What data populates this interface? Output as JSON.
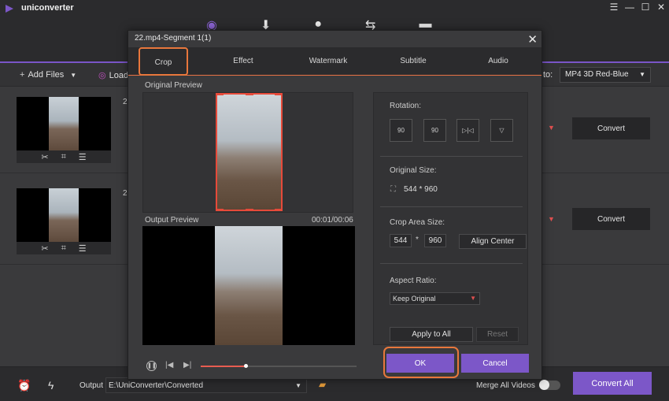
{
  "app": {
    "name": "uniconverter",
    "window_controls": [
      "☰",
      "—",
      "☐",
      "✕"
    ],
    "top_nav_icons": [
      "convert-icon",
      "download-icon",
      "burn-icon",
      "transfer-icon",
      "toolbox-icon"
    ]
  },
  "toolbar": {
    "add_files_label": "Add Files",
    "load_label": "Load",
    "convert_to_label": "to:",
    "format_value": "MP4 3D Red-Blue"
  },
  "file_rows": [
    {
      "name_fragment": "2",
      "convert_label": "Convert"
    },
    {
      "name_fragment": "2",
      "convert_label": "Convert"
    }
  ],
  "bottom_bar": {
    "output_label": "Output",
    "output_path": "E:\\UniConverter\\Converted",
    "merge_label": "Merge All Videos",
    "merge_enabled": false,
    "convert_all_label": "Convert All"
  },
  "dialog": {
    "title": "22.mp4-Segment 1(1)",
    "tabs": [
      {
        "label": "Crop",
        "active": true
      },
      {
        "label": "Effect",
        "active": false
      },
      {
        "label": "Watermark",
        "active": false
      },
      {
        "label": "Subtitle",
        "active": false
      },
      {
        "label": "Audio",
        "active": false
      }
    ],
    "original_preview_label": "Original Preview",
    "output_preview_label": "Output Preview",
    "time": "00:01/00:06",
    "playback_progress": 0.29,
    "rotation_label": "Rotation:",
    "rotation_buttons": [
      "90",
      "90",
      "▷|◁",
      "▽"
    ],
    "original_size_label": "Original Size:",
    "original_size_value": "544 * 960",
    "crop_area_label": "Crop Area Size:",
    "crop_width": "544",
    "crop_times": "*",
    "crop_height": "960",
    "align_center_label": "Align Center",
    "aspect_ratio_label": "Aspect Ratio:",
    "aspect_ratio_value": "Keep Original",
    "apply_all_label": "Apply to All",
    "reset_label": "Reset",
    "ok_label": "OK",
    "cancel_label": "Cancel"
  },
  "colors": {
    "accent_purple": "#7c57c8",
    "highlight_orange": "#e8773c",
    "crop_red": "#e64a3a"
  }
}
